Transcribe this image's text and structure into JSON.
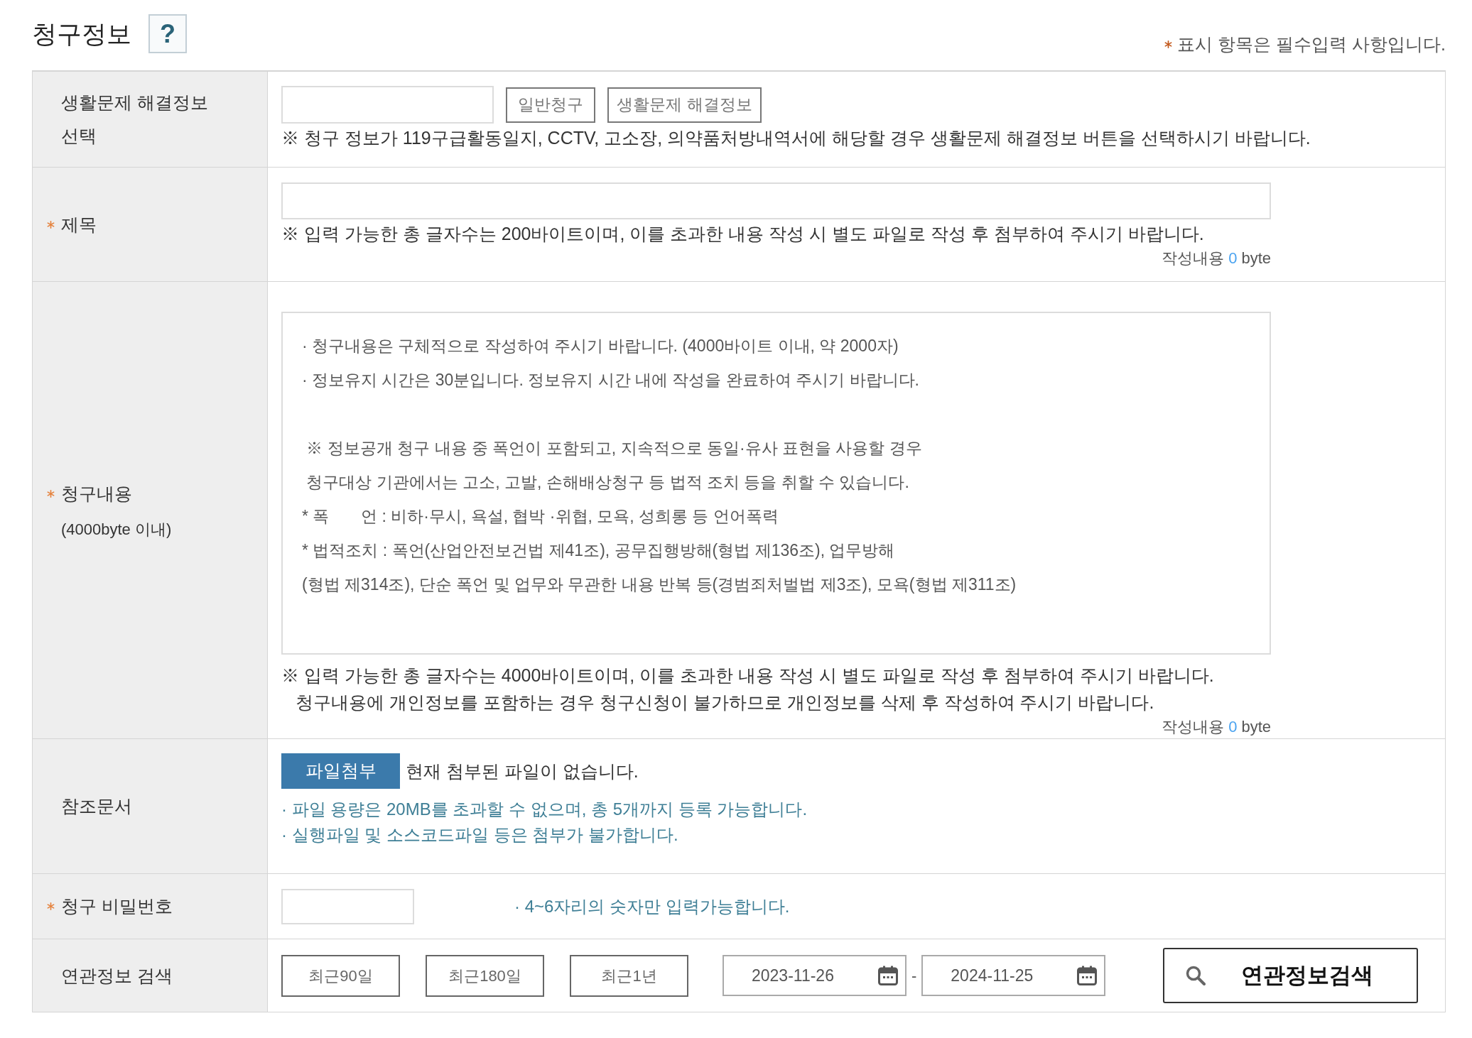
{
  "title": "청구정보",
  "help_button": {
    "label": "?"
  },
  "required_note": {
    "text": "표시 항목은 필수입력 사항입니다."
  },
  "rows": [
    {
      "kind": "type_select",
      "label": "생활문제 해결정보 선택",
      "required": false,
      "buttons": [
        "일반청구",
        "생활문제 해결정보"
      ],
      "note": "※ 청구 정보가 119구급활동일지, CCTV, 고소장, 의약품처방내역서에 해당할 경우 생활문제 해결정보 버튼을 선택하시기 바랍니다."
    },
    {
      "kind": "title",
      "label": "제목",
      "required": true,
      "note": "※ 입력 가능한 총 글자수는 200바이트이며, 이를 초과한 내용 작성 시 별도 파일로 작성 후 첨부하여 주시기 바랍니다.",
      "counter": {
        "label": "작성내용",
        "count": "0",
        "unit": "byte"
      }
    },
    {
      "kind": "content",
      "label": "청구내용",
      "sublabel": "(4000byte 이내)",
      "required": true,
      "placeholder": "· 청구내용은 구체적으로 작성하여 주시기 바랍니다. (4000바이트 이내, 약 2000자)\n· 정보유지 시간은 30분입니다. 정보유지 시간 내에 작성을 완료하여 주시기 바랍니다.\n\n ※ 정보공개 청구 내용 중 폭언이 포함되고, 지속적으로 동일·유사 표현을 사용할 경우\n 청구대상 기관에서는 고소, 고발, 손해배상청구 등 법적 조치 등을 취할 수 있습니다.\n* 폭       언 : 비하·무시, 욕설, 협박 ·위협, 모욕, 성희롱 등 언어폭력\n* 법적조치 : 폭언(산업안전보건법 제41조), 공무집행방해(형법 제136조), 업무방해\n(형법 제314조), 단순 폭언 및 업무와 무관한 내용 반복 등(경범죄처벌법 제3조), 모욕(형법 제311조)",
      "notes": [
        "※ 입력 가능한 총 글자수는 4000바이트이며, 이를 초과한 내용 작성 시 별도 파일로 작성 후 첨부하여 주시기 바랍니다.",
        "청구내용에 개인정보를 포함하는 경우 청구신청이 불가하므로 개인정보를 삭제 후 작성하여 주시기 바랍니다."
      ],
      "counter": {
        "label": "작성내용",
        "count": "0",
        "unit": "byte"
      }
    },
    {
      "kind": "files",
      "label": "참조문서",
      "required": false,
      "button": "파일첨부",
      "status": "현재 첨부된 파일이 없습니다.",
      "hints": [
        "· 파일 용량은 20MB를 초과할 수 없으며, 총 5개까지 등록 가능합니다.",
        "· 실행파일 및 소스코드파일 등은 첨부가 불가합니다."
      ]
    },
    {
      "kind": "password",
      "label": "청구 비밀번호",
      "required": true,
      "hint": "· 4~6자리의 숫자만 입력가능합니다."
    },
    {
      "kind": "related_search",
      "label": "연관정보 검색",
      "required": false,
      "period_buttons": [
        "최근90일",
        "최근180일",
        "최근1년"
      ],
      "date_range": {
        "from": "2023-11-26",
        "separator": "-",
        "to": "2024-11-25"
      },
      "search_button": "연관정보검색"
    }
  ]
}
